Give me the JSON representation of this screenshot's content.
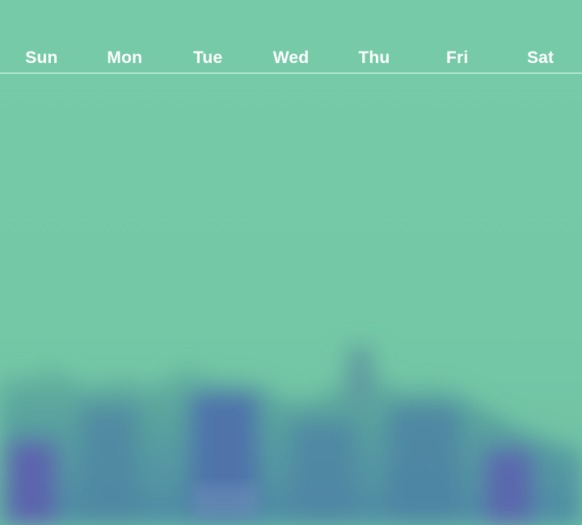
{
  "calendar": {
    "weekdays": [
      "Sun",
      "Mon",
      "Tue",
      "Wed",
      "Thu",
      "Fri",
      "Sat"
    ]
  },
  "colors": {
    "background_top": "#74c9a6",
    "background_bottom": "#5a78a8",
    "header_text": "#ffffff",
    "divider": "#ffffff"
  }
}
